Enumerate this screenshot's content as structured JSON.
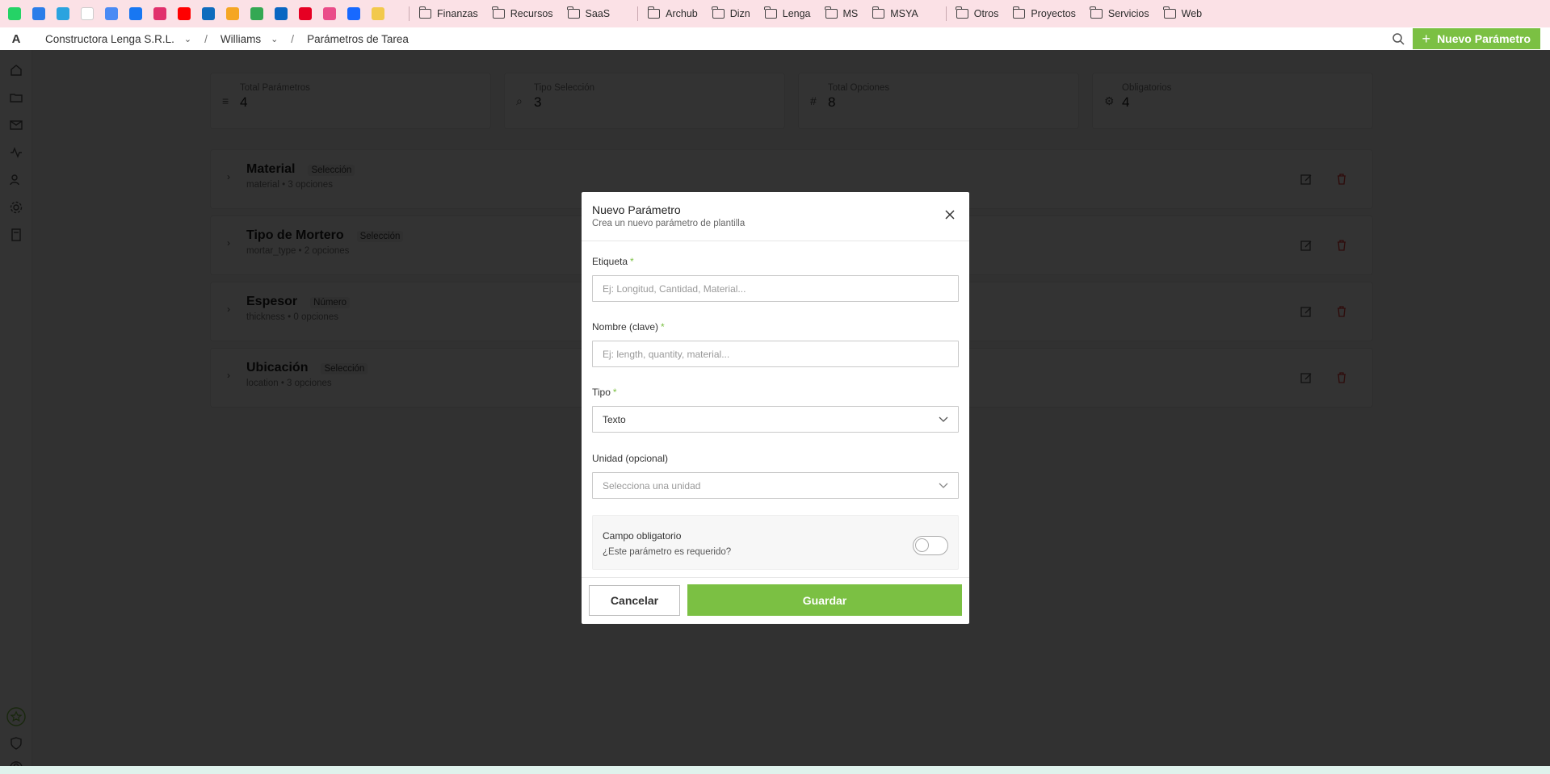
{
  "bookmarks": {
    "icons": [
      {
        "name": "whatsapp-icon",
        "color": "#25d366"
      },
      {
        "name": "checkmark-app-icon",
        "color": "#2b7de9"
      },
      {
        "name": "telegram-icon",
        "color": "#2aa3df"
      },
      {
        "name": "google-icon",
        "color": "#ffffff"
      },
      {
        "name": "calendar-icon",
        "color": "#4a8af4"
      },
      {
        "name": "facebook-icon",
        "color": "#1877f2"
      },
      {
        "name": "instagram-icon",
        "color": "#e1306c"
      },
      {
        "name": "youtube-icon",
        "color": "#ff0000"
      },
      {
        "name": "onedrive-icon",
        "color": "#0f6cbd"
      },
      {
        "name": "tasks-icon",
        "color": "#f5a623"
      },
      {
        "name": "google-drive-icon",
        "color": "#34a853"
      },
      {
        "name": "linkedin-icon",
        "color": "#0a66c2"
      },
      {
        "name": "pinterest-icon",
        "color": "#e60023"
      },
      {
        "name": "dribbble-icon",
        "color": "#ea4c89"
      },
      {
        "name": "behance-icon",
        "color": "#1769ff"
      },
      {
        "name": "food-app-icon",
        "color": "#f2c94c"
      }
    ],
    "folders_group1": [
      "Finanzas",
      "Recursos",
      "SaaS"
    ],
    "folders_group2": [
      "Archub",
      "Dizn",
      "Lenga",
      "MS",
      "MSYA"
    ],
    "folders_group3": [
      "Otros",
      "Proyectos",
      "Servicios",
      "Web"
    ]
  },
  "topbar": {
    "logo": "A",
    "org": "Constructora Lenga S.R.L.",
    "project": "Williams",
    "separator": "/",
    "page": "Parámetros de Tarea",
    "new_button_icon": "+",
    "new_button": "Nuevo Parámetro"
  },
  "stats": [
    {
      "icon": "list-icon",
      "glyph": "≡",
      "label": "Total Parámetros",
      "value": "4"
    },
    {
      "icon": "search-icon",
      "glyph": "⌕",
      "label": "Tipo Selección",
      "value": "3"
    },
    {
      "icon": "hash-icon",
      "glyph": "#",
      "label": "Total Opciones",
      "value": "8"
    },
    {
      "icon": "gear-icon",
      "glyph": "⚙",
      "label": "Obligatorios",
      "value": "4"
    }
  ],
  "parameters": [
    {
      "title": "Material",
      "type": "Selección",
      "sub": "material • 3 opciones"
    },
    {
      "title": "Tipo de Mortero",
      "type": "Selección",
      "sub": "mortar_type • 2 opciones"
    },
    {
      "title": "Espesor",
      "type": "Número",
      "sub": "thickness • 0 opciones"
    },
    {
      "title": "Ubicación",
      "type": "Selección",
      "sub": "location • 3 opciones"
    }
  ],
  "modal": {
    "title": "Nuevo Parámetro",
    "subtitle": "Crea un nuevo parámetro de plantilla",
    "required_mark": "*",
    "label_field": {
      "label": "Etiqueta",
      "placeholder": "Ej: Longitud, Cantidad, Material..."
    },
    "key_field": {
      "label": "Nombre (clave)",
      "placeholder": "Ej: length, quantity, material..."
    },
    "type_field": {
      "label": "Tipo",
      "value": "Texto"
    },
    "unit_field": {
      "label": "Unidad (opcional)",
      "placeholder": "Selecciona una unidad"
    },
    "required_toggle": {
      "title": "Campo obligatorio",
      "subtitle": "¿Este parámetro es requerido?",
      "on": false
    },
    "cancel": "Cancelar",
    "save": "Guardar"
  },
  "colors": {
    "accent": "#7bc043",
    "danger": "#e53935"
  }
}
